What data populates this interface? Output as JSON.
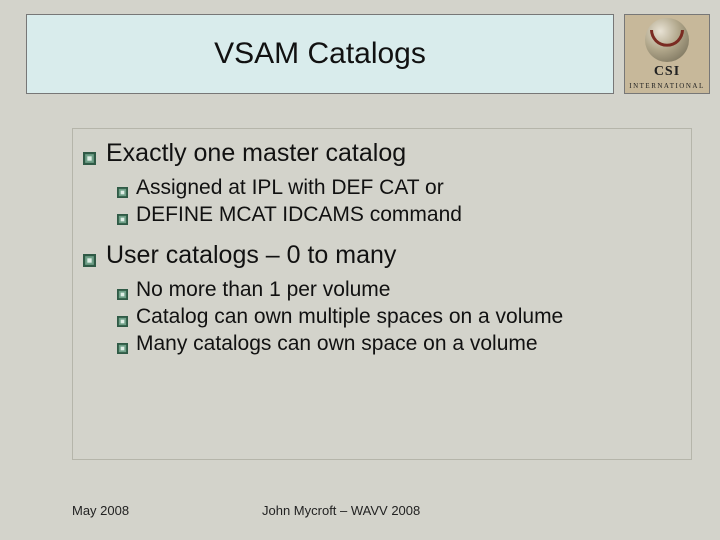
{
  "title": "VSAM Catalogs",
  "logo": {
    "line1": "CSI",
    "line2": "INTERNATIONAL"
  },
  "bullets": [
    {
      "text": "Exactly one master catalog",
      "sub": [
        "Assigned at IPL with DEF CAT or",
        "DEFINE MCAT IDCAMS command"
      ]
    },
    {
      "text": "User catalogs – 0 to many",
      "sub": [
        "No more than 1 per volume",
        "Catalog can own multiple spaces on a volume",
        "Many catalogs can own space on a volume"
      ]
    }
  ],
  "footer": {
    "date": "May 2008",
    "author": "John Mycroft – WAVV 2008"
  }
}
